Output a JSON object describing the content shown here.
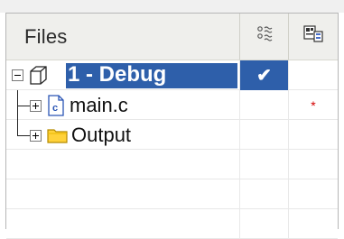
{
  "header": {
    "files_label": "Files",
    "col2_icon": "options-toggle-icon",
    "col3_icon": "compile-options-icon"
  },
  "tree": [
    {
      "label": "1 - Debug",
      "icon": "project-cube-icon",
      "expander": "minus",
      "selected": true,
      "col2": "✔",
      "col3": ""
    },
    {
      "label": "main.c",
      "icon": "c-file-icon",
      "expander": "plus",
      "selected": false,
      "col2": "",
      "col3": "*"
    },
    {
      "label": "Output",
      "icon": "folder-icon",
      "expander": "plus",
      "selected": false,
      "col2": "",
      "col3": ""
    }
  ],
  "colors": {
    "selection": "#2e5faa",
    "header_bg": "#efefec",
    "folder": "#ffd23a",
    "star": "#d40000"
  }
}
